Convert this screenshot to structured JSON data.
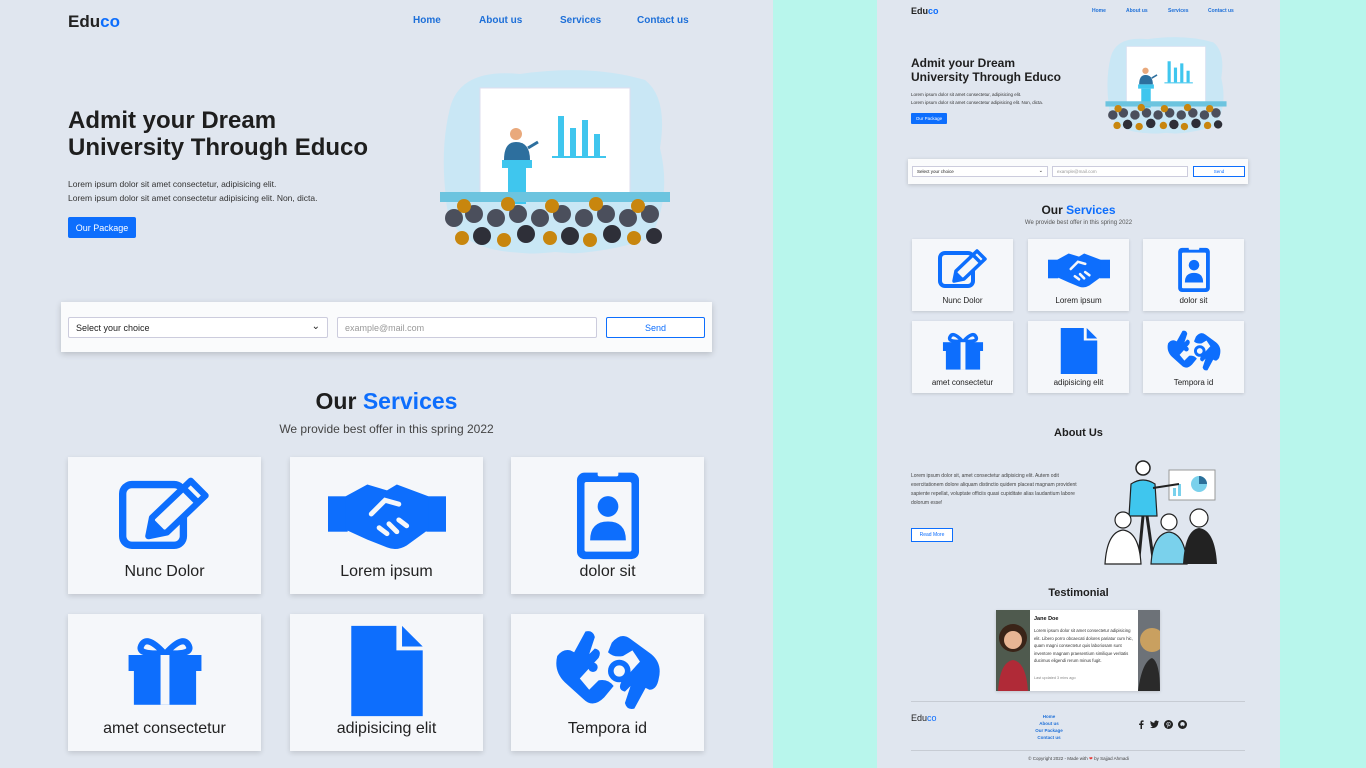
{
  "brand": {
    "prefix": "Edu",
    "suffix": "co"
  },
  "nav": [
    "Home",
    "About us",
    "Services",
    "Contact us"
  ],
  "hero": {
    "title_line1": "Admit your Dream",
    "title_line2": "University Through Educo",
    "text_line1": "Lorem ipsum dolor sit amet consectetur, adipisicing elit.",
    "text_line2": "Lorem ipsum dolor sit amet consectetur adipisicing elit. Non, dicta.",
    "button": "Our Package"
  },
  "form": {
    "select_value": "Select your choice",
    "email_placeholder": "example@mail.com",
    "send": "Send"
  },
  "services": {
    "title_prefix": "Our",
    "title_accent": "Services",
    "subtitle": "We provide best offer in this spring 2022",
    "items": [
      {
        "label": "Nunc Dolor",
        "icon": "pen-to-square-icon"
      },
      {
        "label": "Lorem ipsum",
        "icon": "handshake-icon"
      },
      {
        "label": "dolor sit",
        "icon": "id-badge-icon"
      },
      {
        "label": "amet consectetur",
        "icon": "gift-icon"
      },
      {
        "label": "adipisicing elit",
        "icon": "file-icon"
      },
      {
        "label": "Tempora id",
        "icon": "sign-language-icon"
      }
    ]
  },
  "about": {
    "title": "About Us",
    "text": "Lorem ipsum dolor sit, amet consectetur adipisicing elit. Autem odit exercitationem dolore aliquam distinctio quidem placeat magnam provident sapiente repellat, voluptate officiis quasi cupiditate alias laudantium labore dolorum esse!",
    "button": "Read More"
  },
  "testimonial": {
    "title": "Testimonial",
    "name": "Jane Doe",
    "body": "Lorem ipsum dolor sit amet consectetur adipisicing elit. Libero porro obcaecati dolores pariatur cum hic, quam magni consectetur quis laboriosam sunt inventore magnam praesentium similique veritatis ducimus eligendi rerum minus fugit.",
    "updated": "Last updated 3 mins ago"
  },
  "footer": {
    "links": [
      "Home",
      "About us",
      "Our Package",
      "Contact us"
    ],
    "social": [
      "facebook-icon",
      "twitter-icon",
      "pinterest-icon",
      "github-icon"
    ],
    "copyright_prefix": "© Copyright 2022 - Made with",
    "copyright_suffix": "by Sajjad Ahmadi"
  },
  "colors": {
    "accent": "#0d6efd",
    "page_bg": "#e0e6ef",
    "outer_bg": "#b8f6ec",
    "card_bg": "#f5f7fa"
  }
}
